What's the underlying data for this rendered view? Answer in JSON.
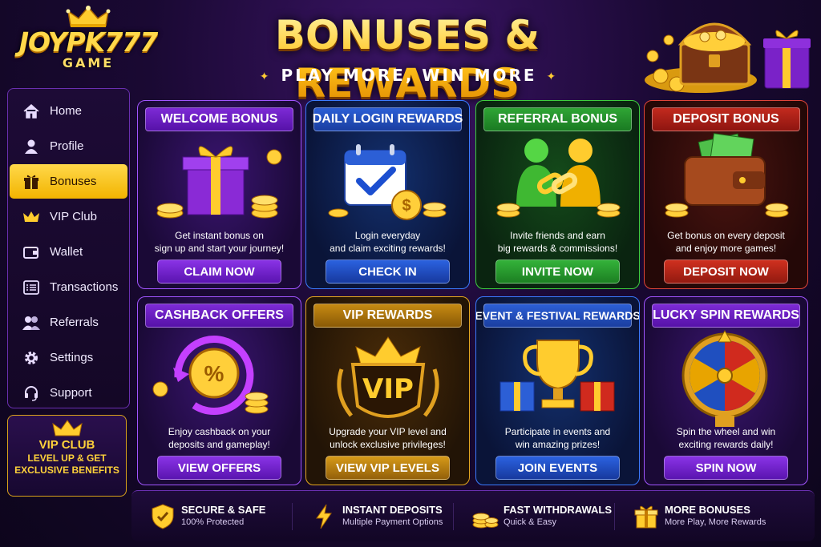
{
  "logo": {
    "title": "JOYPK777",
    "subtitle": "GAME"
  },
  "header": {
    "title": "BONUSES & REWARDS",
    "subtitle": "PLAY MORE, WIN MORE"
  },
  "sidebar": {
    "items": [
      {
        "label": "Home",
        "icon": "home-icon",
        "active": false
      },
      {
        "label": "Profile",
        "icon": "profile-icon",
        "active": false
      },
      {
        "label": "Bonuses",
        "icon": "gift-icon",
        "active": true
      },
      {
        "label": "VIP Club",
        "icon": "crown-icon",
        "active": false
      },
      {
        "label": "Wallet",
        "icon": "wallet-icon",
        "active": false
      },
      {
        "label": "Transactions",
        "icon": "list-icon",
        "active": false
      },
      {
        "label": "Referrals",
        "icon": "users-icon",
        "active": false
      },
      {
        "label": "Settings",
        "icon": "gear-icon",
        "active": false
      },
      {
        "label": "Support",
        "icon": "headset-icon",
        "active": false
      }
    ]
  },
  "vip_card": {
    "title": "VIP CLUB",
    "line1": "LEVEL UP & GET",
    "line2": "EXCLUSIVE BENEFITS"
  },
  "cards": [
    {
      "title": "WELCOME BONUS",
      "desc1": "Get instant bonus on",
      "desc2": "sign up and start your journey!",
      "button": "CLAIM NOW",
      "theme": "purple"
    },
    {
      "title": "DAILY LOGIN REWARDS",
      "desc1": "Login everyday",
      "desc2": "and claim exciting rewards!",
      "button": "CHECK IN",
      "theme": "blue"
    },
    {
      "title": "REFERRAL BONUS",
      "desc1": "Invite friends and earn",
      "desc2": "big rewards & commissions!",
      "button": "INVITE NOW",
      "theme": "green"
    },
    {
      "title": "DEPOSIT BONUS",
      "desc1": "Get bonus on every deposit",
      "desc2": "and enjoy more games!",
      "button": "DEPOSIT NOW",
      "theme": "red"
    },
    {
      "title": "CASHBACK OFFERS",
      "desc1": "Enjoy cashback on your",
      "desc2": "deposits and gameplay!",
      "button": "VIEW OFFERS",
      "theme": "purple"
    },
    {
      "title": "VIP REWARDS",
      "desc1": "Upgrade your VIP level and",
      "desc2": "unlock exclusive privileges!",
      "button": "VIEW VIP LEVELS",
      "theme": "gold"
    },
    {
      "title": "EVENT & FESTIVAL REWARDS",
      "desc1": "Participate in events and",
      "desc2": "win amazing prizes!",
      "button": "JOIN EVENTS",
      "theme": "blue"
    },
    {
      "title": "LUCKY SPIN REWARDS",
      "desc1": "Spin the wheel and win",
      "desc2": "exciting rewards daily!",
      "button": "SPIN NOW",
      "theme": "purple"
    }
  ],
  "card_art": {
    "vip_text": "VIP",
    "percent_text": "%",
    "coin_text": "$"
  },
  "footer": [
    {
      "title": "SECURE & SAFE",
      "subtitle": "100% Protected",
      "icon": "shield-icon"
    },
    {
      "title": "INSTANT DEPOSITS",
      "subtitle": "Multiple Payment Options",
      "icon": "lightning-icon"
    },
    {
      "title": "FAST WITHDRAWALS",
      "subtitle": "Quick & Easy",
      "icon": "coins-icon"
    },
    {
      "title": "MORE BONUSES",
      "subtitle": "More Play, More Rewards",
      "icon": "gift-icon"
    }
  ],
  "colors": {
    "gold": "#ffcc33",
    "purple": "#7d2ad6",
    "blue": "#2c5fd6",
    "green": "#2fa535",
    "red": "#c22a1e",
    "background": "#1a0933"
  }
}
